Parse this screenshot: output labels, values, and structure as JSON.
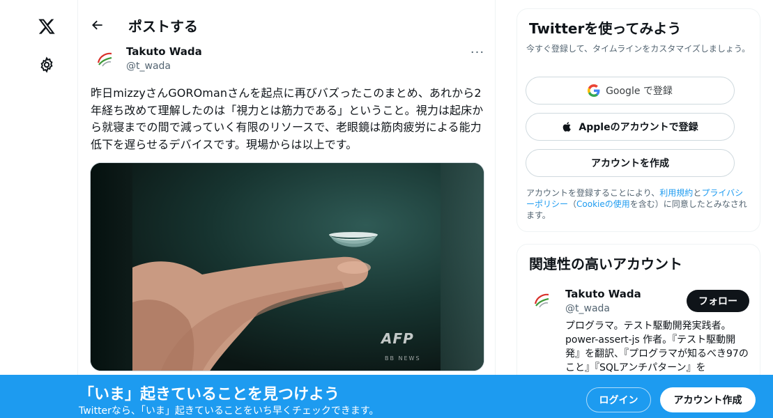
{
  "nav": {
    "logo_icon": "x-logo-icon",
    "settings_icon": "gear-icon"
  },
  "header": {
    "title": "ポストする",
    "back_icon": "arrow-left-icon"
  },
  "post": {
    "author_name": "Takuto Wada",
    "author_handle": "@t_wada",
    "more_label": "···",
    "text": "昨日mizzyさんGOROmanさんを起点に再びバズったこのまとめ、あれから2年経ち改めて理解したのは「視力とは筋力である」ということ。視力は起床から就寝までの間で減っていく有限のリソースで、老眼鏡は筋肉疲労による能力低下を遅らせるデバイスです。現場からは以上です。",
    "media": {
      "watermark": "AFP",
      "watermark_sub": "BB NEWS"
    }
  },
  "signup_card": {
    "title": "Twitterを使ってみよう",
    "subtitle": "今すぐ登録して、タイムラインをカスタマイズしましょう。",
    "google_label": "Google で登録",
    "apple_label": "Appleのアカウントで登録",
    "create_label": "アカウントを作成",
    "terms_prefix": "アカウントを登録することにより、",
    "terms_link": "利用規約",
    "terms_and": "と",
    "privacy_link": "プライバシーポリシー",
    "terms_paren_open": "（",
    "cookie_link": "Cookieの使用",
    "terms_suffix": "を含む）に同意したとみなされます。"
  },
  "related_card": {
    "title": "関連性の高いアカウント",
    "name": "Takuto Wada",
    "handle": "@t_wada",
    "follow_label": "フォロー",
    "bio": "プログラマ。テスト駆動開発実践者。power-assert-js 作者。『テスト駆動開発』を翻訳、『プログラマが知るべき97のこと』『SQLアンチパターン』を"
  },
  "banner": {
    "title": "「いま」起きていることを見つけよう",
    "subtitle": "Twitterなら、「いま」起きていることをいち早くチェックできます。",
    "login_label": "ログイン",
    "signup_label": "アカウント作成"
  },
  "colors": {
    "accent": "#1d9bf0",
    "text": "#0f1419",
    "muted": "#536471"
  }
}
